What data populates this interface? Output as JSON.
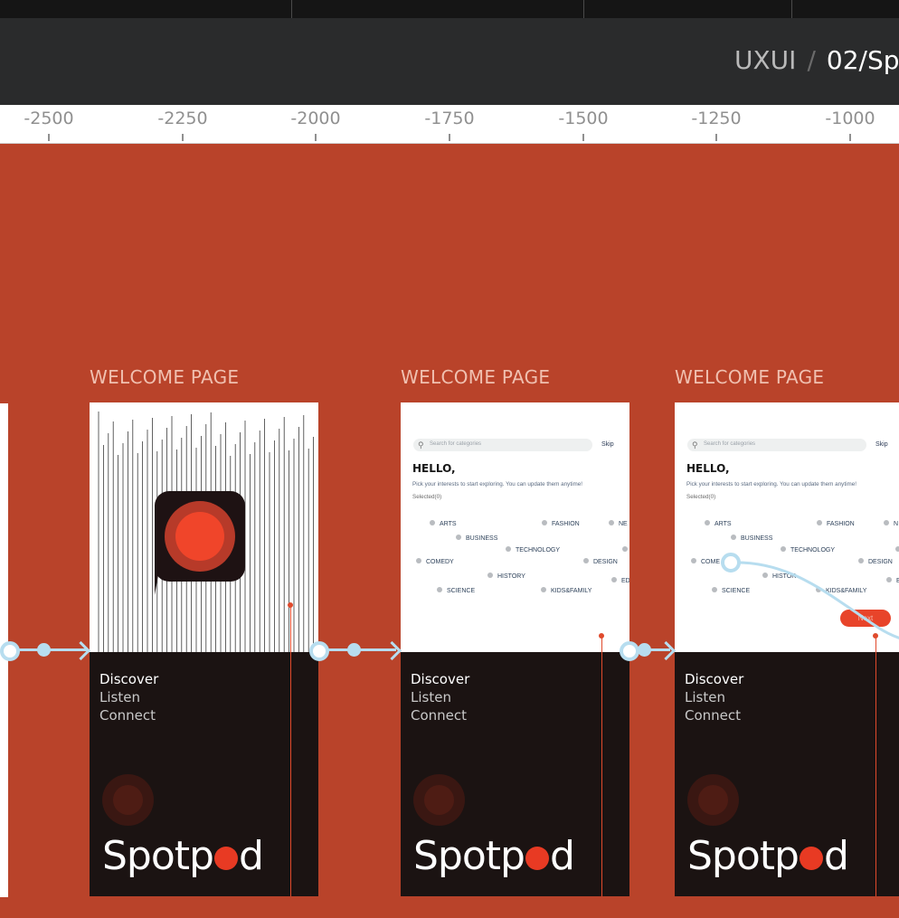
{
  "breadcrumb": {
    "project": "UXUI",
    "separator": "/",
    "file": "02/Sp"
  },
  "ruler": {
    "ticks": [
      "-2500",
      "-2250",
      "-2000",
      "-1750",
      "-1500",
      "-1250",
      "-1000"
    ]
  },
  "frames": [
    {
      "label": "WELCOME PAGE",
      "tagline": [
        "Discover",
        "Listen",
        "Connect"
      ],
      "brand": {
        "before": "Spotp",
        "after": "d"
      }
    },
    {
      "label": "WELCOME PAGE",
      "search_placeholder": "Search for categories",
      "skip": "Skip",
      "hello": "HELLO,",
      "subtext": "Pick your interests to start exploring. You can update them anytime!",
      "selected": "Selected(0)",
      "categories": [
        "ARTS",
        "FASHION",
        "NE",
        "BUSINESS",
        "TECHNOLOGY",
        "COMEDY",
        "DESIGN",
        "HISTORY",
        "ED",
        "SCIENCE",
        "KIDS&FAMILY"
      ],
      "tagline": [
        "Discover",
        "Listen",
        "Connect"
      ],
      "brand": {
        "before": "Spotp",
        "after": "d"
      }
    },
    {
      "label": "WELCOME PAGE",
      "search_placeholder": "Search for categories",
      "skip": "Skip",
      "hello": "HELLO,",
      "subtext": "Pick your interests to start exploring. You can update them anytime!",
      "selected": "Selected(0)",
      "categories": [
        "ARTS",
        "FASHION",
        "N",
        "BUSINESS",
        "TECHNOLOGY",
        "COME",
        "DESIGN",
        "HISTOR",
        "E",
        "SCIENCE",
        "KIDS&FAMILY"
      ],
      "next": "Next",
      "tagline": [
        "Discover",
        "Listen",
        "Connect"
      ],
      "brand": {
        "before": "Spotp",
        "after": "d"
      }
    }
  ],
  "colors": {
    "canvas": "#b9432a",
    "header": "#2a2b2c",
    "accent": "#e83a23",
    "connector": "#b7ddef",
    "dark_panel": "#1b1312"
  }
}
